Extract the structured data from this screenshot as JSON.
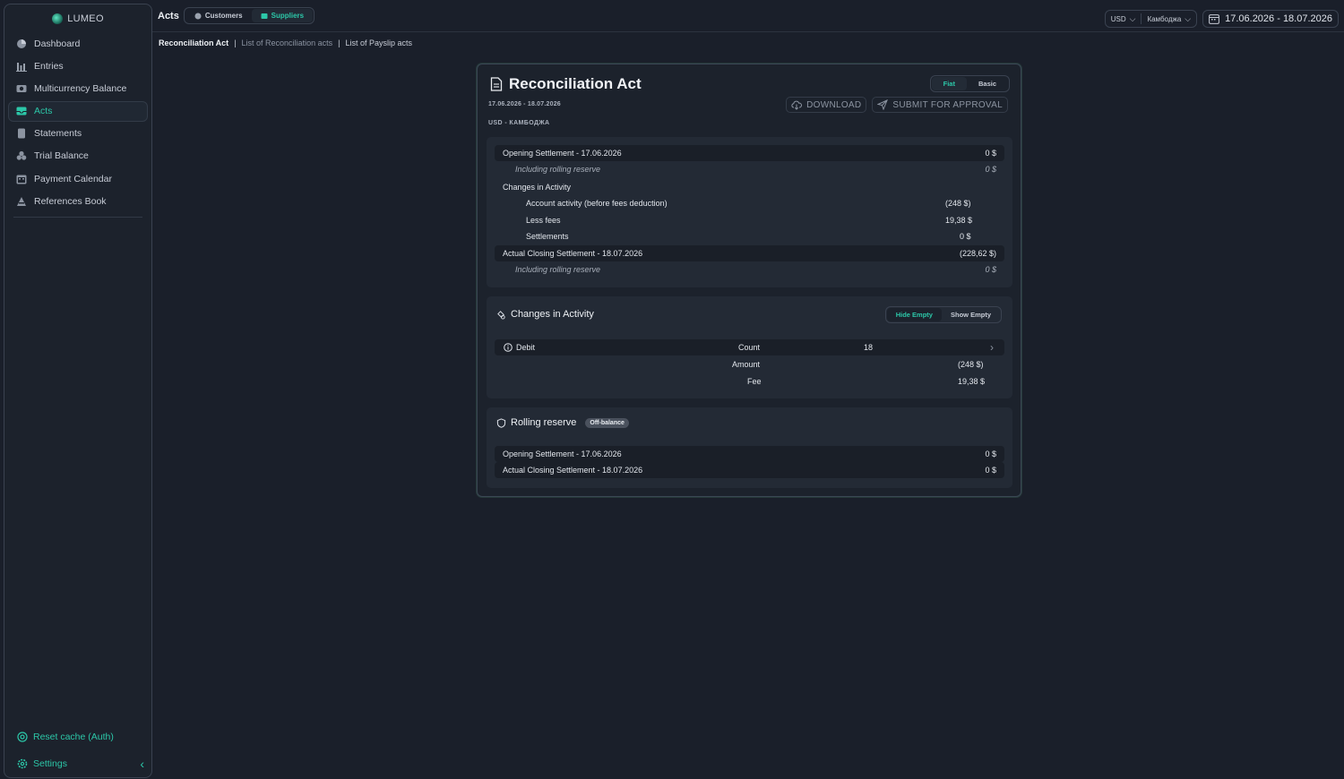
{
  "app": {
    "name": "LUMEO"
  },
  "sidebar": {
    "items": [
      {
        "label": "Dashboard",
        "icon": "dashboard-icon"
      },
      {
        "label": "Entries",
        "icon": "entries-icon"
      },
      {
        "label": "Multicurrency Balance",
        "icon": "multicurrency-icon"
      },
      {
        "label": "Acts",
        "icon": "acts-icon",
        "active": true
      },
      {
        "label": "Statements",
        "icon": "statements-icon"
      },
      {
        "label": "Trial Balance",
        "icon": "trial-balance-icon"
      },
      {
        "label": "Payment Calendar",
        "icon": "calendar-icon"
      },
      {
        "label": "References Book",
        "icon": "references-icon"
      }
    ],
    "reset_cache": "Reset cache (Auth)",
    "settings": "Settings"
  },
  "topbar": {
    "title": "Acts",
    "tabs": [
      {
        "label": "Customers",
        "active": false
      },
      {
        "label": "Suppliers",
        "active": true
      }
    ],
    "currency": "USD",
    "region": "Камбоджа",
    "date_range": "17.06.2026 - 18.07.2026"
  },
  "breadcrumbs": {
    "current": "Reconciliation Act",
    "separator": "|",
    "link1": "List of Reconciliation acts",
    "link2": "List of Payslip acts"
  },
  "act": {
    "title": "Reconciliation Act",
    "date": "17.06.2026 - 18.07.2026",
    "subtitle": "USD - КАМБОДЖА",
    "modes": [
      {
        "label": "Fiat",
        "active": true
      },
      {
        "label": "Basic",
        "active": false
      }
    ],
    "download": "DOWNLOAD",
    "submit": "SUBMIT FOR APPROVAL"
  },
  "summary": {
    "opening_label": "Opening Settlement - 17.06.2026",
    "opening_value": "0 $",
    "rolling1_label": "Including rolling reserve",
    "rolling1_value": "0 $",
    "changes_label": "Changes in Activity",
    "activity_label": "Account activity (before fees deduction)",
    "activity_value": "(248 $)",
    "fees_label": "Less fees",
    "fees_value": "19,38 $",
    "settlements_label": "Settlements",
    "settlements_value": "0 $",
    "closing_label": "Actual Closing Settlement - 18.07.2026",
    "closing_value": "(228,62 $)",
    "rolling2_label": "Including rolling reserve",
    "rolling2_value": "0 $"
  },
  "changes": {
    "title": "Changes in Activity",
    "hide_empty": "Hide Empty",
    "show_empty": "Show Empty",
    "debit_label": "Debit",
    "count_label": "Count",
    "count_value": "18",
    "amount_label": "Amount",
    "amount_value": "(248 $)",
    "fee_label": "Fee",
    "fee_value": "19,38 $"
  },
  "rolling": {
    "title": "Rolling reserve",
    "badge": "Off-balance",
    "opening_label": "Opening Settlement - 17.06.2026",
    "opening_value": "0 $",
    "closing_label": "Actual Closing Settlement - 18.07.2026",
    "closing_value": "0 $"
  },
  "colors": {
    "accent": "#2cc7a8",
    "background": "#1a1f2a",
    "panel": "#232a35"
  }
}
